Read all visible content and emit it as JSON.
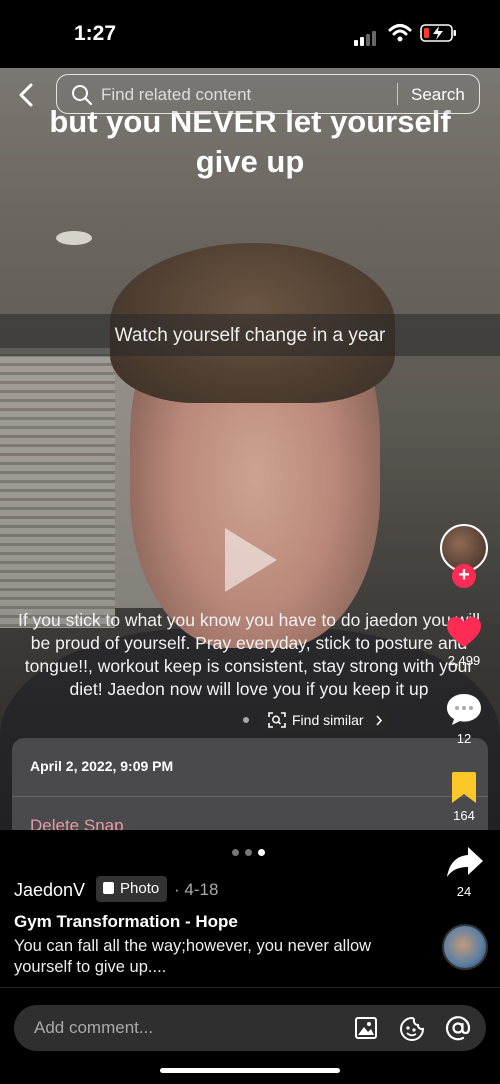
{
  "status_bar": {
    "time": "1:27"
  },
  "search": {
    "placeholder": "Find related content",
    "button": "Search"
  },
  "photo": {
    "top_caption": "but you NEVER let yourself give up",
    "mid_caption": "Watch yourself change in a year",
    "overlay_text": "If you stick to what you know you have to do jaedon you will be proud of yourself. Pray everyday, stick to posture and tongue!!, workout keep is consistent, stay strong with your diet! Jaedon now will love you if you keep it up",
    "find_similar": "Find similar"
  },
  "snap_card": {
    "date": "April 2, 2022, 9:09 PM",
    "delete": "Delete Snap"
  },
  "rail": {
    "likes": "2,499",
    "comments": "12",
    "saves": "164",
    "shares": "24"
  },
  "post": {
    "author": "JaedonV",
    "type_tag": "Photo",
    "date": "· 4-18",
    "title": "Gym Transformation - Hope",
    "description": "You can fall all the way;however, you never allow yourself to give up...."
  },
  "comment": {
    "placeholder": "Add comment..."
  },
  "colors": {
    "like": "#fe2c55",
    "save": "#fcc829",
    "delete_text": "#e79aa6"
  }
}
